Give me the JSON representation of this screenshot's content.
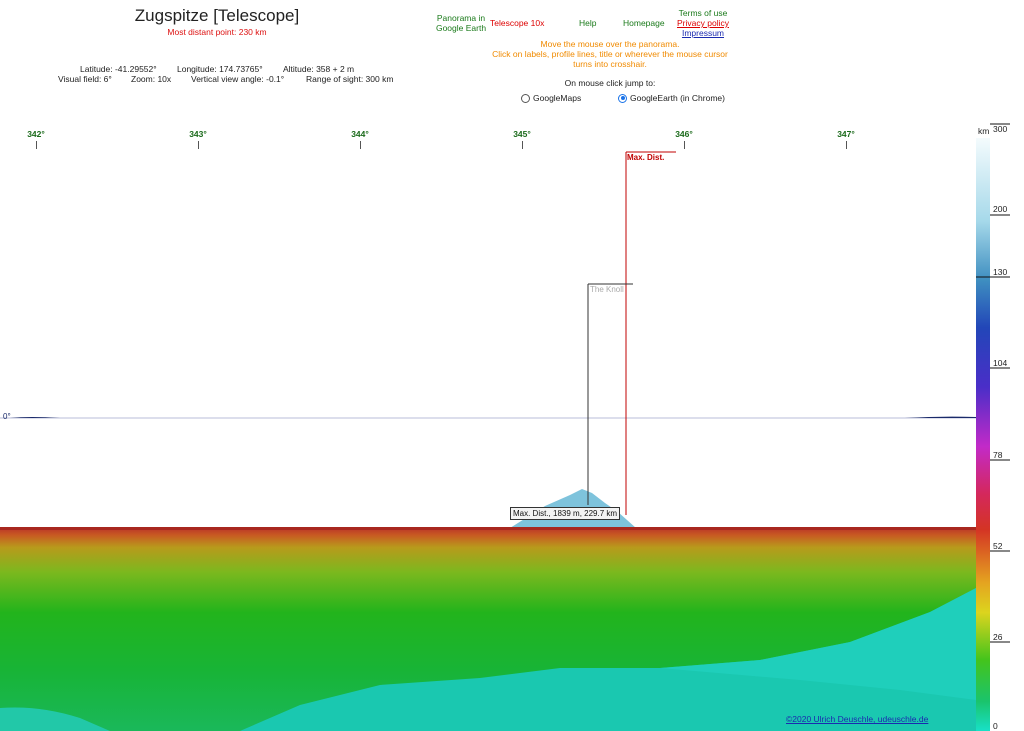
{
  "header": {
    "title": "Zugspitze [Telescope]",
    "subtitle": "Most distant point: 230 km",
    "info": {
      "latitude": "Latitude: -41.29552°",
      "longitude": "Longitude: 174.73765°",
      "altitude": "Altitude: 358 + 2 m",
      "visual_field": "Visual field: 6°",
      "zoom": "Zoom: 10x",
      "vertical_angle": "Vertical view angle: -0.1°",
      "range": "Range of sight: 300 km"
    }
  },
  "nav": {
    "panorama_line1": "Panorama in",
    "panorama_line2": "Google Earth",
    "telescope": "Telescope 10x",
    "help": "Help",
    "homepage": "Homepage",
    "terms": "Terms of use",
    "privacy": "Privacy policy",
    "impressum": "Impressum"
  },
  "hint": {
    "line1": "Move the mouse over the panorama.",
    "line2": "Click on labels, profile lines, title or wherever the mouse cursor",
    "line3": "turns into crosshair."
  },
  "jump": {
    "label": "On mouse click jump to:",
    "options": [
      "GoogleMaps",
      "GoogleEarth (in Chrome)"
    ],
    "selected": 1
  },
  "panorama": {
    "azimuth_labels": [
      "342°",
      "343°",
      "344°",
      "345°",
      "346°",
      "347°"
    ],
    "horizon_label": "0°",
    "max_dist_label": "Max. Dist.",
    "peak_label": "The Knoll",
    "tooltip": "Max. Dist., 1839 m, 229.7 km"
  },
  "scale": {
    "unit": "km",
    "labels": [
      "300",
      "200",
      "130",
      "104",
      "78",
      "52",
      "26",
      "0"
    ]
  },
  "footer": {
    "copyright": "©2020 Ulrich Deuschle, udeuschle.de"
  }
}
